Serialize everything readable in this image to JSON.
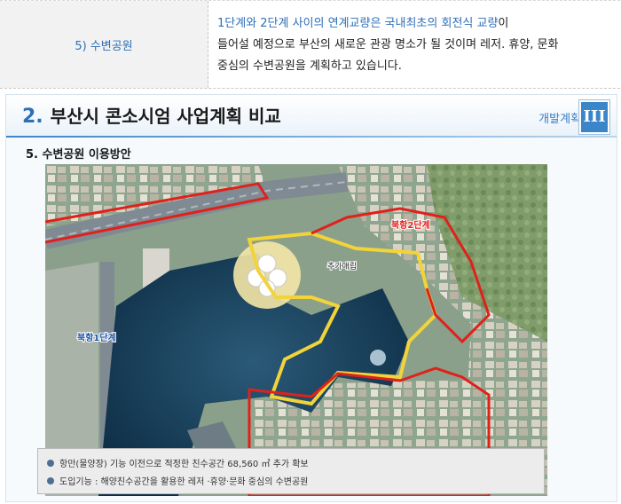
{
  "table_row": {
    "label": "5) 수변공원",
    "desc_highlight": "1단계와 2단계 사이의 연계교량은 국내최초의 회전식 교량",
    "desc_rest_1": "이",
    "desc_line2": "들어설 예정으로 부산의 새로운 관광 명소가 될 것이며 레저. 휴양, 문화",
    "desc_line3": "중심의 수변공원을 계획하고 있습니다."
  },
  "slide": {
    "number": "2.",
    "title": "부산시 콘소시엄 사업계획 비교",
    "section_tag": "개발계획",
    "roman_numeral": "III",
    "subtitle": "5. 수변공원 이용방안",
    "map_labels": {
      "phase1": "북항1단계",
      "phase2": "북항2단계",
      "extra_fill": "추가매립"
    },
    "legend": [
      "항만(물양장) 기능 이전으로 적정한 친수공간 68,560 ㎡ 추가 확보",
      "도입기능 : 해양친수공간을 활용한 레저 ·휴양·문화 중심의 수변공원"
    ]
  },
  "colors": {
    "accent_blue": "#2d6fb8",
    "boundary_red": "#e0211b",
    "boundary_yellow": "#f2d33a",
    "water": "#143a57"
  }
}
